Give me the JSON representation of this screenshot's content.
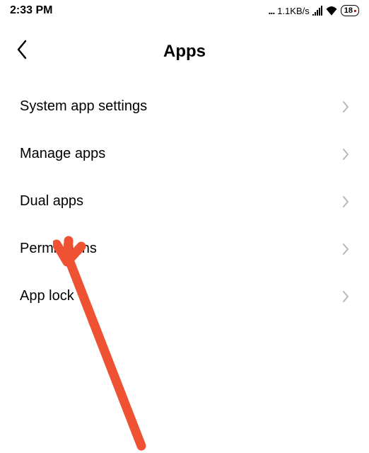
{
  "status_bar": {
    "time": "2:33 PM",
    "dots": "...",
    "speed": "1.1KB/s",
    "battery": "18"
  },
  "header": {
    "title": "Apps"
  },
  "settings": {
    "items": [
      {
        "label": "System app settings"
      },
      {
        "label": "Manage apps"
      },
      {
        "label": "Dual apps"
      },
      {
        "label": "Permissions"
      },
      {
        "label": "App lock"
      }
    ]
  }
}
